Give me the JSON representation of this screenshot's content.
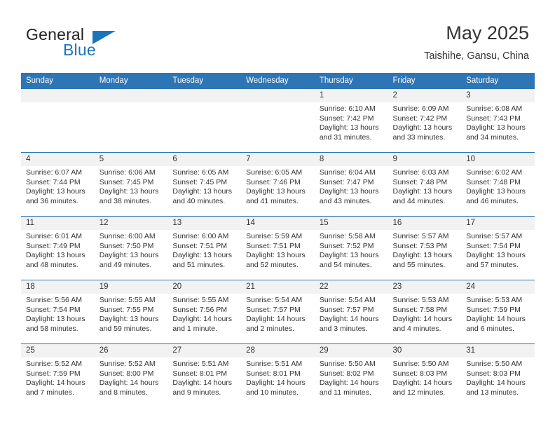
{
  "logo": {
    "word1": "General",
    "word2": "Blue",
    "accent_color": "#1b75bb"
  },
  "header": {
    "title": "May 2025",
    "subtitle": "Taishihe, Gansu, China",
    "header_bg": "#2e75b6",
    "daynum_bg": "#f2f2f2"
  },
  "weekday_headers": [
    "Sunday",
    "Monday",
    "Tuesday",
    "Wednesday",
    "Thursday",
    "Friday",
    "Saturday"
  ],
  "labels": {
    "sunrise": "Sunrise:",
    "sunset": "Sunset:",
    "daylight": "Daylight:"
  },
  "weeks": [
    [
      {
        "day": "",
        "lines": []
      },
      {
        "day": "",
        "lines": []
      },
      {
        "day": "",
        "lines": []
      },
      {
        "day": "",
        "lines": []
      },
      {
        "day": "1",
        "lines": [
          "Sunrise: 6:10 AM",
          "Sunset: 7:42 PM",
          "Daylight: 13 hours",
          "and 31 minutes."
        ]
      },
      {
        "day": "2",
        "lines": [
          "Sunrise: 6:09 AM",
          "Sunset: 7:42 PM",
          "Daylight: 13 hours",
          "and 33 minutes."
        ]
      },
      {
        "day": "3",
        "lines": [
          "Sunrise: 6:08 AM",
          "Sunset: 7:43 PM",
          "Daylight: 13 hours",
          "and 34 minutes."
        ]
      }
    ],
    [
      {
        "day": "4",
        "lines": [
          "Sunrise: 6:07 AM",
          "Sunset: 7:44 PM",
          "Daylight: 13 hours",
          "and 36 minutes."
        ]
      },
      {
        "day": "5",
        "lines": [
          "Sunrise: 6:06 AM",
          "Sunset: 7:45 PM",
          "Daylight: 13 hours",
          "and 38 minutes."
        ]
      },
      {
        "day": "6",
        "lines": [
          "Sunrise: 6:05 AM",
          "Sunset: 7:45 PM",
          "Daylight: 13 hours",
          "and 40 minutes."
        ]
      },
      {
        "day": "7",
        "lines": [
          "Sunrise: 6:05 AM",
          "Sunset: 7:46 PM",
          "Daylight: 13 hours",
          "and 41 minutes."
        ]
      },
      {
        "day": "8",
        "lines": [
          "Sunrise: 6:04 AM",
          "Sunset: 7:47 PM",
          "Daylight: 13 hours",
          "and 43 minutes."
        ]
      },
      {
        "day": "9",
        "lines": [
          "Sunrise: 6:03 AM",
          "Sunset: 7:48 PM",
          "Daylight: 13 hours",
          "and 44 minutes."
        ]
      },
      {
        "day": "10",
        "lines": [
          "Sunrise: 6:02 AM",
          "Sunset: 7:48 PM",
          "Daylight: 13 hours",
          "and 46 minutes."
        ]
      }
    ],
    [
      {
        "day": "11",
        "lines": [
          "Sunrise: 6:01 AM",
          "Sunset: 7:49 PM",
          "Daylight: 13 hours",
          "and 48 minutes."
        ]
      },
      {
        "day": "12",
        "lines": [
          "Sunrise: 6:00 AM",
          "Sunset: 7:50 PM",
          "Daylight: 13 hours",
          "and 49 minutes."
        ]
      },
      {
        "day": "13",
        "lines": [
          "Sunrise: 6:00 AM",
          "Sunset: 7:51 PM",
          "Daylight: 13 hours",
          "and 51 minutes."
        ]
      },
      {
        "day": "14",
        "lines": [
          "Sunrise: 5:59 AM",
          "Sunset: 7:51 PM",
          "Daylight: 13 hours",
          "and 52 minutes."
        ]
      },
      {
        "day": "15",
        "lines": [
          "Sunrise: 5:58 AM",
          "Sunset: 7:52 PM",
          "Daylight: 13 hours",
          "and 54 minutes."
        ]
      },
      {
        "day": "16",
        "lines": [
          "Sunrise: 5:57 AM",
          "Sunset: 7:53 PM",
          "Daylight: 13 hours",
          "and 55 minutes."
        ]
      },
      {
        "day": "17",
        "lines": [
          "Sunrise: 5:57 AM",
          "Sunset: 7:54 PM",
          "Daylight: 13 hours",
          "and 57 minutes."
        ]
      }
    ],
    [
      {
        "day": "18",
        "lines": [
          "Sunrise: 5:56 AM",
          "Sunset: 7:54 PM",
          "Daylight: 13 hours",
          "and 58 minutes."
        ]
      },
      {
        "day": "19",
        "lines": [
          "Sunrise: 5:55 AM",
          "Sunset: 7:55 PM",
          "Daylight: 13 hours",
          "and 59 minutes."
        ]
      },
      {
        "day": "20",
        "lines": [
          "Sunrise: 5:55 AM",
          "Sunset: 7:56 PM",
          "Daylight: 14 hours",
          "and 1 minute."
        ]
      },
      {
        "day": "21",
        "lines": [
          "Sunrise: 5:54 AM",
          "Sunset: 7:57 PM",
          "Daylight: 14 hours",
          "and 2 minutes."
        ]
      },
      {
        "day": "22",
        "lines": [
          "Sunrise: 5:54 AM",
          "Sunset: 7:57 PM",
          "Daylight: 14 hours",
          "and 3 minutes."
        ]
      },
      {
        "day": "23",
        "lines": [
          "Sunrise: 5:53 AM",
          "Sunset: 7:58 PM",
          "Daylight: 14 hours",
          "and 4 minutes."
        ]
      },
      {
        "day": "24",
        "lines": [
          "Sunrise: 5:53 AM",
          "Sunset: 7:59 PM",
          "Daylight: 14 hours",
          "and 6 minutes."
        ]
      }
    ],
    [
      {
        "day": "25",
        "lines": [
          "Sunrise: 5:52 AM",
          "Sunset: 7:59 PM",
          "Daylight: 14 hours",
          "and 7 minutes."
        ]
      },
      {
        "day": "26",
        "lines": [
          "Sunrise: 5:52 AM",
          "Sunset: 8:00 PM",
          "Daylight: 14 hours",
          "and 8 minutes."
        ]
      },
      {
        "day": "27",
        "lines": [
          "Sunrise: 5:51 AM",
          "Sunset: 8:01 PM",
          "Daylight: 14 hours",
          "and 9 minutes."
        ]
      },
      {
        "day": "28",
        "lines": [
          "Sunrise: 5:51 AM",
          "Sunset: 8:01 PM",
          "Daylight: 14 hours",
          "and 10 minutes."
        ]
      },
      {
        "day": "29",
        "lines": [
          "Sunrise: 5:50 AM",
          "Sunset: 8:02 PM",
          "Daylight: 14 hours",
          "and 11 minutes."
        ]
      },
      {
        "day": "30",
        "lines": [
          "Sunrise: 5:50 AM",
          "Sunset: 8:03 PM",
          "Daylight: 14 hours",
          "and 12 minutes."
        ]
      },
      {
        "day": "31",
        "lines": [
          "Sunrise: 5:50 AM",
          "Sunset: 8:03 PM",
          "Daylight: 14 hours",
          "and 13 minutes."
        ]
      }
    ]
  ]
}
